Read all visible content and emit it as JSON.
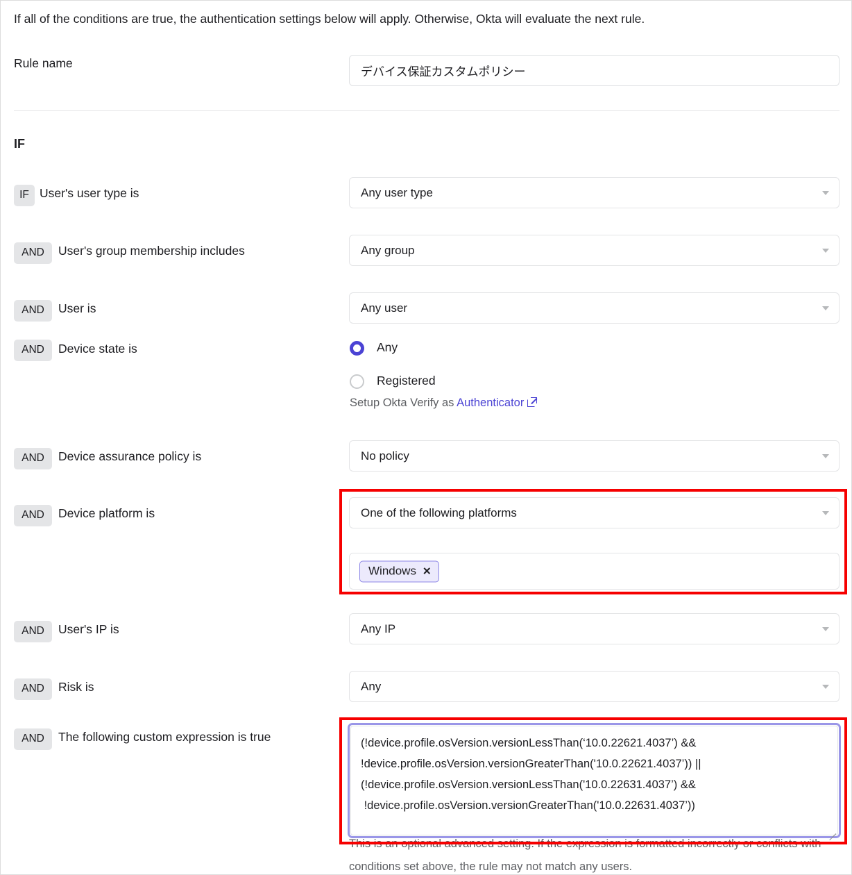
{
  "intro": "If all of the conditions are true, the authentication settings below will apply. Otherwise, Okta will evaluate the next rule.",
  "rule_name": {
    "label": "Rule name",
    "value": "デバイス保証カスタムポリシー"
  },
  "if_heading": "IF",
  "conditions": [
    {
      "op": "IF",
      "label": "User's user type is",
      "value": "Any user type"
    },
    {
      "op": "AND",
      "label": "User's group membership includes",
      "value": "Any group"
    },
    {
      "op": "AND",
      "label": "User is",
      "value": "Any user"
    },
    {
      "op": "AND",
      "label": "Device state is",
      "value": ""
    },
    {
      "op": "AND",
      "label": "Device assurance policy is",
      "value": "No policy"
    },
    {
      "op": "AND",
      "label": "Device platform is",
      "value": "One of the following platforms"
    },
    {
      "op": "AND",
      "label": "User's IP is",
      "value": "Any IP"
    },
    {
      "op": "AND",
      "label": "Risk is",
      "value": "Any"
    },
    {
      "op": "AND",
      "label": "The following custom expression is true",
      "value": ""
    }
  ],
  "device_state": {
    "options": [
      {
        "label": "Any",
        "selected": true
      },
      {
        "label": "Registered",
        "selected": false
      }
    ],
    "note_prefix": "Setup Okta Verify as ",
    "note_link": "Authenticator",
    "link_icon": "external-link-icon"
  },
  "device_platform": {
    "selected_chips": [
      {
        "label": "Windows",
        "remove_icon": "close-icon"
      }
    ]
  },
  "custom_expression": {
    "value": "(!device.profile.osVersion.versionLessThan(‘10.0.22621.4037’) &&\n!device.profile.osVersion.versionGreaterThan('10.0.22621.4037’)) ||\n(!device.profile.osVersion.versionLessThan('10.0.22631.4037’) &&\n !device.profile.osVersion.versionGreaterThan('10.0.22631.4037’))",
    "helper_text": "This is an optional advanced setting. If the expression is formatted incorrectly or conflicts with conditions set above, the rule may not match any users."
  },
  "highlights": {
    "color": "#f60000",
    "regions": [
      "device-platform",
      "custom-expression"
    ]
  },
  "colors": {
    "accent": "#4b43d4",
    "chip_bg": "#e4e5e7",
    "pill_bg": "#eceafc",
    "pill_border": "#8c86e6",
    "text": "#1d1d21",
    "muted": "#5c5e62",
    "highlight": "#f60000"
  }
}
